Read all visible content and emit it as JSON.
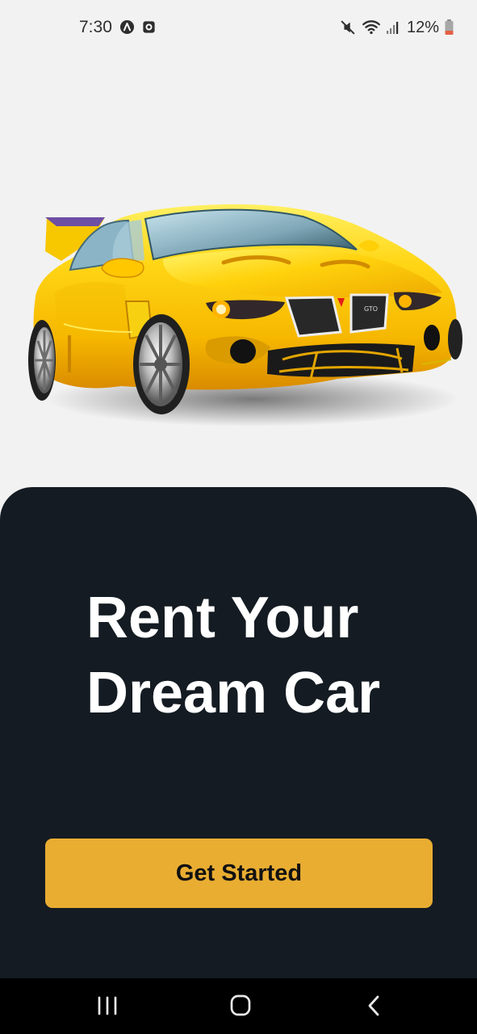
{
  "status_bar": {
    "time": "7:30",
    "battery": "12%",
    "left_icons": [
      "app-notification-icon",
      "screen-record-icon"
    ],
    "right_icons": [
      "mute-icon",
      "wifi-icon",
      "signal-icon",
      "battery-icon"
    ]
  },
  "hero": {
    "image": "yellow-sports-car"
  },
  "onboarding": {
    "headline_line1": "Rent Your",
    "headline_line2": "Dream Car",
    "cta_label": "Get Started"
  },
  "navigation": {
    "buttons": [
      "recent-apps",
      "home",
      "back"
    ]
  },
  "colors": {
    "background": "#f2f2f2",
    "panel": "#141b22",
    "accent": "#e9ad32",
    "headline_text": "#ffffff",
    "button_text": "#111111",
    "nav_bar": "#000000",
    "car_body": "#f5c400"
  }
}
